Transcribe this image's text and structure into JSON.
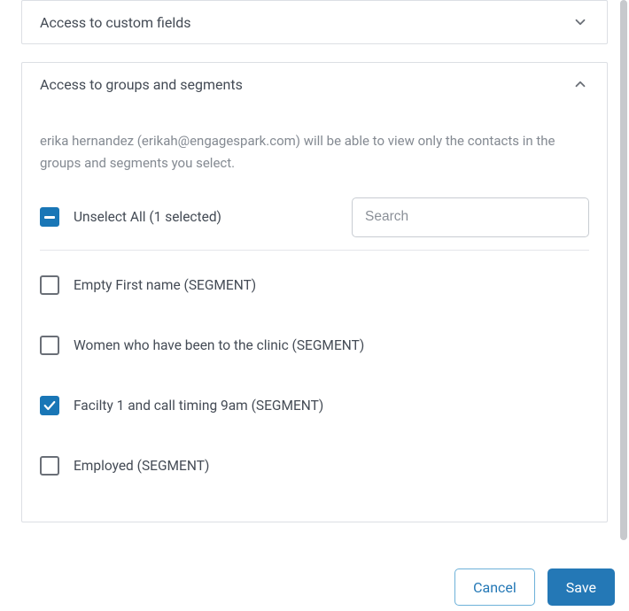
{
  "panels": {
    "customFields": {
      "title": "Access to custom fields"
    },
    "groups": {
      "title": "Access to groups and segments",
      "description": "erika hernandez (erikah@engagespark.com) will be able to view only the contacts in the groups and segments you select.",
      "unselectAllLabel": "Unselect All (1 selected)",
      "searchPlaceholder": "Search",
      "items": [
        {
          "label": "Empty First name (SEGMENT)",
          "checked": false
        },
        {
          "label": "Women who have been to the clinic (SEGMENT)",
          "checked": false
        },
        {
          "label": "Facilty 1 and call timing 9am (SEGMENT)",
          "checked": true
        },
        {
          "label": "Employed (SEGMENT)",
          "checked": false
        }
      ]
    }
  },
  "footer": {
    "cancel": "Cancel",
    "save": "Save"
  },
  "colors": {
    "accent": "#2478b6",
    "checkbox": "#1976b6",
    "border": "#dcdfe4",
    "muted": "#848a92"
  }
}
